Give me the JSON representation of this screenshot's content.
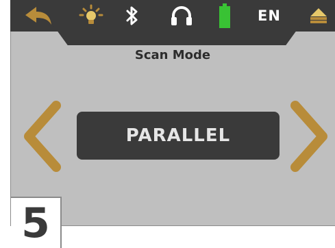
{
  "status_bar": {
    "icons": [
      "back-arrow-icon",
      "brightness-icon",
      "bluetooth-icon",
      "headphones-icon",
      "battery-icon",
      "device-logo-icon"
    ],
    "language": "EN",
    "battery_color": "#39c234",
    "accent_color": "#b88c3a"
  },
  "screen": {
    "title": "Scan Mode",
    "mode_value": "PARALLEL",
    "prev_icon": "chevron-left-icon",
    "next_icon": "chevron-right-icon"
  },
  "step_label": "5"
}
